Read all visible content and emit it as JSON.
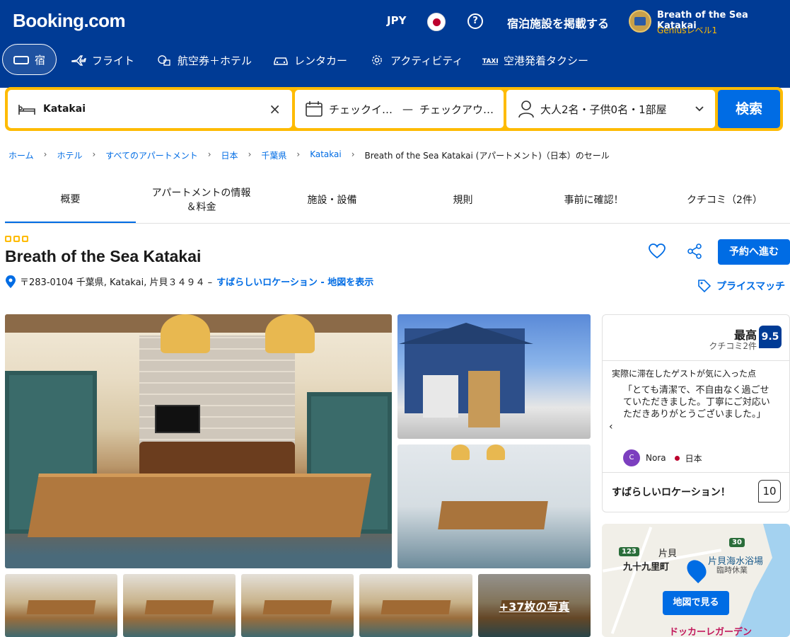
{
  "header": {
    "logo": "Booking.com",
    "currency": "JPY",
    "list_property": "宿泊施設を掲載する",
    "user_name": "Breath of the Sea Katakai",
    "user_level": "Geniusレベル1",
    "help_icon": "?"
  },
  "nav": {
    "items": [
      {
        "label": "宿",
        "icon": "bed-icon"
      },
      {
        "label": "フライト",
        "icon": "plane-icon"
      },
      {
        "label": "航空券＋ホテル",
        "icon": "plane-hotel-icon"
      },
      {
        "label": "レンタカー",
        "icon": "car-icon"
      },
      {
        "label": "アクティビティ",
        "icon": "activity-icon"
      },
      {
        "label": "空港発着タクシー",
        "icon": "taxi-icon"
      }
    ]
  },
  "search": {
    "destination": "Katakai",
    "checkin": "チェックイ…",
    "dash": "—",
    "checkout": "チェックアウ…",
    "guests": "大人2名・子供0名・1部屋",
    "button": "検索"
  },
  "breadcrumb": [
    "ホーム",
    "ホテル",
    "すべてのアパートメント",
    "日本",
    "千葉県",
    "Katakai",
    "Breath of the Sea Katakai (アパートメント)（日本）のセール"
  ],
  "tabs": [
    "概要",
    "アパートメントの情報\n＆料金",
    "施設・設備",
    "規則",
    "事前に確認！",
    "クチコミ（2件）"
  ],
  "property": {
    "name": "Breath of the Sea Katakai",
    "address": "〒283-0104 千葉県, Katakai, 片貝３４９４ –",
    "location_link": "すばらしいロケーション - 地図を表示",
    "reserve": "予約へ進む",
    "price_match": "プライスマッチ",
    "more_photos": "+37枚の写真"
  },
  "review": {
    "rating_word": "最高",
    "count": "クチコミ2件",
    "score": "9.5",
    "head": "実際に滞在したゲストが気に入った点",
    "quote": "「とても清潔で、不自由なく過ごせていただきました。丁寧にご対応いただきありがとうございました。」",
    "avatar_letter": "C",
    "reviewer": "Nora",
    "country": "日本",
    "location_label": "すばらしいロケーション！",
    "location_score": "10"
  },
  "map": {
    "label_kataika": "片貝",
    "label_kujukuri": "九十九里町",
    "label_beach": "片貝海水浴場",
    "label_closed": "臨時休業",
    "label_dokka": "ドッカーレガーデン",
    "route_123": "123",
    "route_30": "30",
    "button": "地図で見る"
  },
  "colors": {
    "brand_blue": "#003b95",
    "action_blue": "#006ce4",
    "search_yellow": "#febb02"
  }
}
